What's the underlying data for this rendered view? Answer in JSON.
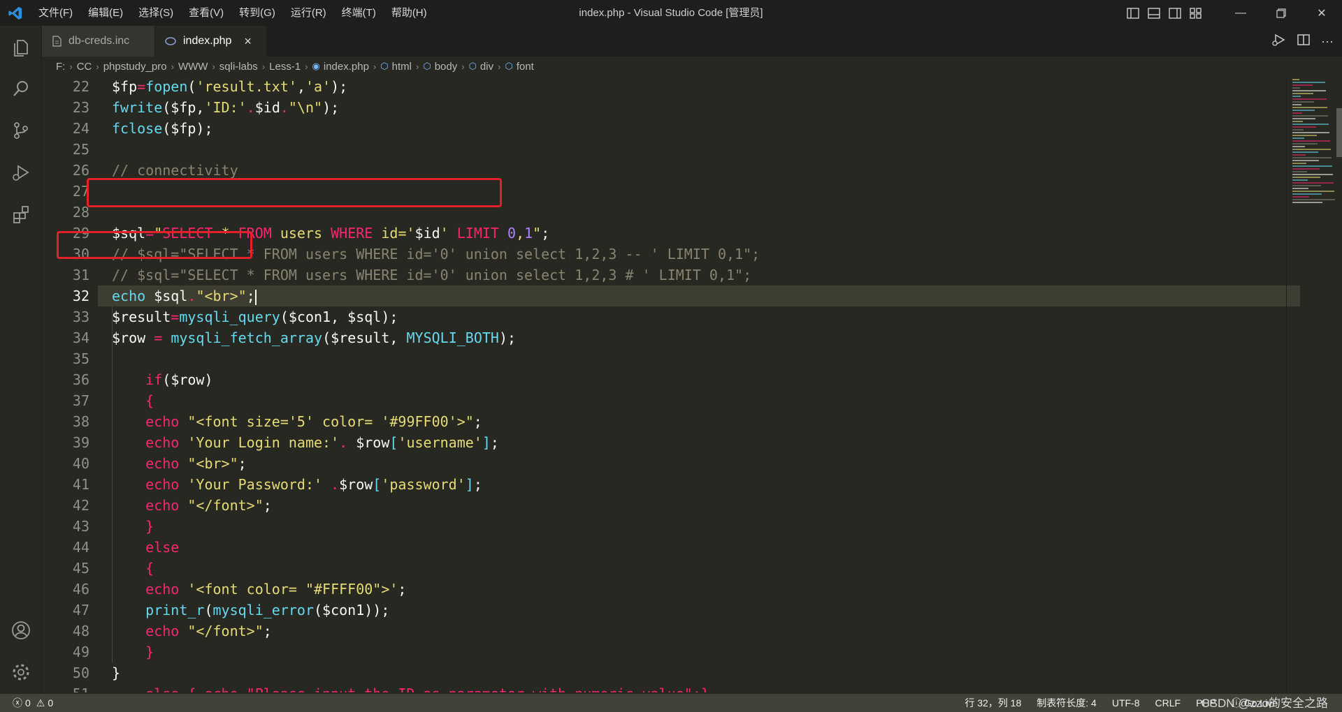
{
  "title_bar": {
    "menu": [
      "文件(F)",
      "编辑(E)",
      "选择(S)",
      "查看(V)",
      "转到(G)",
      "运行(R)",
      "终端(T)",
      "帮助(H)"
    ],
    "window_title": "index.php - Visual Studio Code [管理员]"
  },
  "tabs": [
    {
      "label": "db-creds.inc",
      "active": false
    },
    {
      "label": "index.php",
      "active": true,
      "close": "×"
    }
  ],
  "breadcrumb": [
    "F:",
    "CC",
    "phpstudy_pro",
    "WWW",
    "sqli-labs",
    "Less-1",
    "index.php",
    "html",
    "body",
    "div",
    "font"
  ],
  "editor": {
    "current_line": "32",
    "lines": [
      {
        "n": "22",
        "tokens": [
          [
            "$fp",
            "#f8f8f2"
          ],
          [
            "=",
            "#f92672"
          ],
          [
            "fopen",
            "#66d9ef"
          ],
          [
            "(",
            "#f8f8f2"
          ],
          [
            "'result.txt'",
            "#e6db74"
          ],
          [
            ",",
            "#f8f8f2"
          ],
          [
            "'a'",
            "#e6db74"
          ],
          [
            ");",
            "#f8f8f2"
          ]
        ]
      },
      {
        "n": "23",
        "tokens": [
          [
            "fwrite",
            "#66d9ef"
          ],
          [
            "(",
            "#f8f8f2"
          ],
          [
            "$fp",
            "#f8f8f2"
          ],
          [
            ",",
            "#f8f8f2"
          ],
          [
            "'ID:'",
            "#e6db74"
          ],
          [
            ".",
            "#f92672"
          ],
          [
            "$id",
            "#f8f8f2"
          ],
          [
            ".",
            "#f92672"
          ],
          [
            "\"\\n\"",
            "#e6db74"
          ],
          [
            ");",
            "#f8f8f2"
          ]
        ]
      },
      {
        "n": "24",
        "tokens": [
          [
            "fclose",
            "#66d9ef"
          ],
          [
            "(",
            "#f8f8f2"
          ],
          [
            "$fp",
            "#f8f8f2"
          ],
          [
            ");",
            "#f8f8f2"
          ]
        ]
      },
      {
        "n": "25",
        "tokens": []
      },
      {
        "n": "26",
        "tokens": [
          [
            "// connectivity",
            "#88846f"
          ]
        ]
      },
      {
        "n": "27",
        "tokens": []
      },
      {
        "n": "28",
        "tokens": []
      },
      {
        "n": "29",
        "tokens": [
          [
            "$sql",
            "#f8f8f2"
          ],
          [
            "=",
            "#f92672"
          ],
          [
            "\"",
            "#e6db74"
          ],
          [
            "SELECT",
            "#f92672"
          ],
          [
            " * ",
            "#e6db74"
          ],
          [
            "FROM",
            "#f92672"
          ],
          [
            " users ",
            "#e6db74"
          ],
          [
            "WHERE",
            "#f92672"
          ],
          [
            " id='",
            "#e6db74"
          ],
          [
            "$id",
            "#f8f8f2"
          ],
          [
            "' ",
            "#e6db74"
          ],
          [
            "LIMIT",
            "#f92672"
          ],
          [
            " ",
            "#e6db74"
          ],
          [
            "0",
            "#ae81ff"
          ],
          [
            ",",
            "#e6db74"
          ],
          [
            "1",
            "#ae81ff"
          ],
          [
            "\"",
            "#e6db74"
          ],
          [
            ";",
            "#f8f8f2"
          ]
        ]
      },
      {
        "n": "30",
        "tokens": [
          [
            "// $sql=\"SELECT * FROM users WHERE id='0' union select 1,2,3 -- ' LIMIT 0,1\";",
            "#88846f"
          ]
        ]
      },
      {
        "n": "31",
        "tokens": [
          [
            "// $sql=\"SELECT * FROM users WHERE id='0' union select 1,2,3 # ' LIMIT 0,1\";",
            "#88846f"
          ]
        ]
      },
      {
        "n": "32",
        "tokens": [
          [
            "echo",
            "#66d9ef"
          ],
          [
            " $sql",
            "#f8f8f2"
          ],
          [
            ".",
            "#f92672"
          ],
          [
            "\"<br>\"",
            "#e6db74"
          ],
          [
            ";",
            "#f8f8f2"
          ]
        ]
      },
      {
        "n": "33",
        "tokens": [
          [
            "$result",
            "#f8f8f2"
          ],
          [
            "=",
            "#f92672"
          ],
          [
            "mysqli_query",
            "#66d9ef"
          ],
          [
            "(",
            "#f8f8f2"
          ],
          [
            "$con1, $sql",
            "#f8f8f2"
          ],
          [
            ");",
            "#f8f8f2"
          ]
        ]
      },
      {
        "n": "34",
        "tokens": [
          [
            "$row ",
            "#f8f8f2"
          ],
          [
            "=",
            "#f92672"
          ],
          [
            " ",
            "#f8f8f2"
          ],
          [
            "mysqli_fetch_array",
            "#66d9ef"
          ],
          [
            "(",
            "#f8f8f2"
          ],
          [
            "$result, ",
            "#f8f8f2"
          ],
          [
            "MYSQLI_BOTH",
            "#66d9ef"
          ],
          [
            ");",
            "#f8f8f2"
          ]
        ]
      },
      {
        "n": "35",
        "tokens": []
      },
      {
        "n": "36",
        "tokens": [
          [
            "    ",
            "#f8f8f2"
          ],
          [
            "if",
            "#f92672"
          ],
          [
            "(",
            "#f8f8f2"
          ],
          [
            "$row",
            "#f8f8f2"
          ],
          [
            ")",
            "#f8f8f2"
          ]
        ]
      },
      {
        "n": "37",
        "tokens": [
          [
            "    {",
            "#f92672"
          ]
        ]
      },
      {
        "n": "38",
        "tokens": [
          [
            "    echo ",
            "#f92672"
          ],
          [
            "\"<font size='5' color= '#99FF00'>\"",
            "#e6db74"
          ],
          [
            ";",
            "#f8f8f2"
          ]
        ]
      },
      {
        "n": "39",
        "tokens": [
          [
            "    echo ",
            "#f92672"
          ],
          [
            "'Your Login name:'",
            "#e6db74"
          ],
          [
            ". ",
            "#f92672"
          ],
          [
            "$row",
            "#f8f8f2"
          ],
          [
            "[",
            "#66d9ef"
          ],
          [
            "'username'",
            "#e6db74"
          ],
          [
            "]",
            "#66d9ef"
          ],
          [
            ";",
            "#f8f8f2"
          ]
        ]
      },
      {
        "n": "40",
        "tokens": [
          [
            "    echo ",
            "#f92672"
          ],
          [
            "\"<br>\"",
            "#e6db74"
          ],
          [
            ";",
            "#f8f8f2"
          ]
        ]
      },
      {
        "n": "41",
        "tokens": [
          [
            "    echo ",
            "#f92672"
          ],
          [
            "'Your Password:' ",
            "#e6db74"
          ],
          [
            ".",
            "#f92672"
          ],
          [
            "$row",
            "#f8f8f2"
          ],
          [
            "[",
            "#66d9ef"
          ],
          [
            "'password'",
            "#e6db74"
          ],
          [
            "]",
            "#66d9ef"
          ],
          [
            ";",
            "#f8f8f2"
          ]
        ]
      },
      {
        "n": "42",
        "tokens": [
          [
            "    echo ",
            "#f92672"
          ],
          [
            "\"</font>\"",
            "#e6db74"
          ],
          [
            ";",
            "#f8f8f2"
          ]
        ]
      },
      {
        "n": "43",
        "tokens": [
          [
            "    }",
            "#f92672"
          ]
        ]
      },
      {
        "n": "44",
        "tokens": [
          [
            "    else",
            "#f92672"
          ]
        ]
      },
      {
        "n": "45",
        "tokens": [
          [
            "    {",
            "#f92672"
          ]
        ]
      },
      {
        "n": "46",
        "tokens": [
          [
            "    echo ",
            "#f92672"
          ],
          [
            "'<font color= \"#FFFF00\">'",
            "#e6db74"
          ],
          [
            ";",
            "#f8f8f2"
          ]
        ]
      },
      {
        "n": "47",
        "tokens": [
          [
            "    print_r",
            "#66d9ef"
          ],
          [
            "(",
            "#f8f8f2"
          ],
          [
            "mysqli_error",
            "#66d9ef"
          ],
          [
            "(",
            "#f8f8f2"
          ],
          [
            "$con1",
            "#f8f8f2"
          ],
          [
            "));",
            "#f8f8f2"
          ]
        ]
      },
      {
        "n": "48",
        "tokens": [
          [
            "    echo ",
            "#f92672"
          ],
          [
            "\"</font>\"",
            "#e6db74"
          ],
          [
            ";",
            "#f8f8f2"
          ]
        ]
      },
      {
        "n": "49",
        "tokens": [
          [
            "    }",
            "#f92672"
          ]
        ]
      },
      {
        "n": "50",
        "tokens": [
          [
            "}",
            "#f8f8f2"
          ]
        ]
      },
      {
        "n": "51",
        "tokens": [
          [
            "    else { echo \"Please input the ID as parameter with numeric value\";}",
            "#f92672"
          ]
        ]
      }
    ]
  },
  "status_bar": {
    "errors": "0",
    "warnings": "0",
    "position": "行 32，列 18",
    "indent": "制表符长度: 4",
    "encoding": "UTF-8",
    "eol": "CRLF",
    "language": "PHP",
    "go_live": "Go Live"
  },
  "watermark": "CSDN @zzo的安全之路",
  "colors": {
    "highlight_box": "#e4202a",
    "background": "#272822"
  }
}
